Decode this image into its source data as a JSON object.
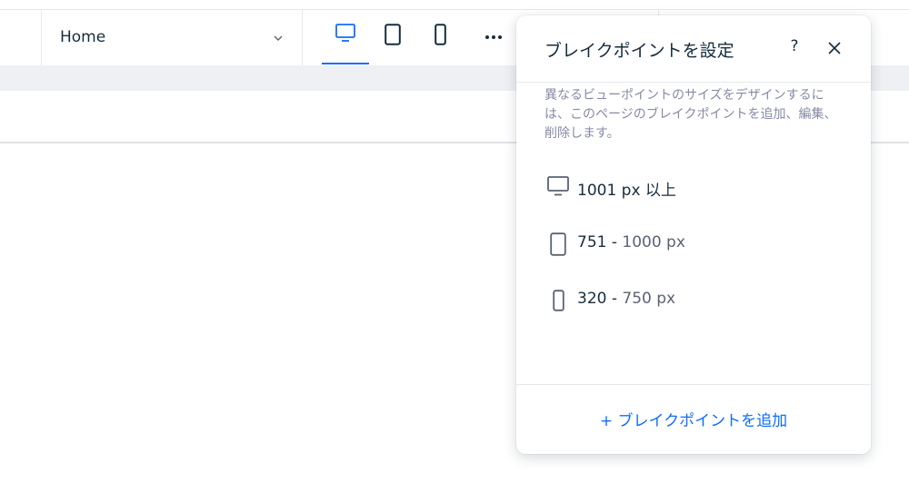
{
  "toolbar": {
    "page_select": {
      "value": "Home",
      "icon": "chevron-down-icon"
    },
    "devices": [
      {
        "name": "desktop",
        "icon": "desktop-icon",
        "active": true
      },
      {
        "name": "tablet",
        "icon": "tablet-icon",
        "active": false
      },
      {
        "name": "mobile",
        "icon": "mobile-icon",
        "active": false
      }
    ],
    "more": {
      "icon": "more-horizontal-icon"
    }
  },
  "panel": {
    "title": "ブレイクポイントを設定",
    "help_label": "?",
    "close_icon": "close-icon",
    "description": "異なるビューポイントのサイズをデザインするには、このページのブレイクポイントを追加、編集、削除します。",
    "breakpoints": [
      {
        "icon": "desktop-icon",
        "from": "1001 px 以上",
        "to": ""
      },
      {
        "icon": "tablet-icon",
        "from": "751 - ",
        "to": "1000 px"
      },
      {
        "icon": "mobile-icon",
        "from": "320 - ",
        "to": "750 px"
      }
    ],
    "add_label": "+ ブレイクポイントを追加"
  },
  "colors": {
    "accent": "#116dff",
    "text": "#162d3d",
    "muted": "#868aa5",
    "border": "#e6e8ec"
  }
}
